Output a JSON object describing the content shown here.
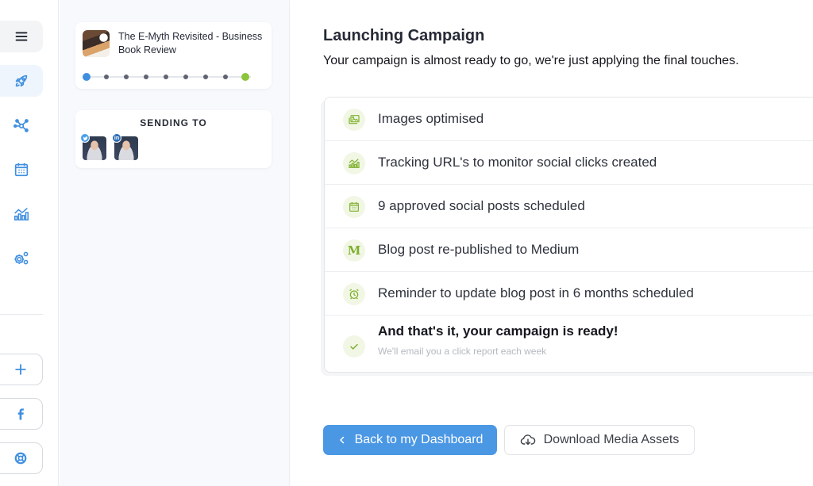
{
  "colors": {
    "accent_blue": "#4a97e4",
    "success_green": "#7fb02e",
    "success_bg": "#f1f7e4",
    "sidebar_icon": "#3f8fe0"
  },
  "sidebar": {
    "items": [
      {
        "name": "menu",
        "icon": "hamburger-icon"
      },
      {
        "name": "campaigns",
        "icon": "rocket-icon",
        "active": true
      },
      {
        "name": "network",
        "icon": "network-icon"
      },
      {
        "name": "calendar",
        "icon": "calendar-icon"
      },
      {
        "name": "analytics",
        "icon": "analytics-icon"
      },
      {
        "name": "settings",
        "icon": "gears-icon"
      }
    ],
    "bottom_items": [
      {
        "name": "add",
        "icon": "plus-icon"
      },
      {
        "name": "facebook",
        "icon": "facebook-icon"
      },
      {
        "name": "help",
        "icon": "lifebuoy-icon"
      }
    ]
  },
  "campaign_card": {
    "title": "The E-Myth Revisited - Business Book Review",
    "steps_total": 9,
    "steps_completed": 9
  },
  "sending_to": {
    "label": "SENDING TO",
    "accounts": [
      {
        "network": "twitter",
        "badge": "t"
      },
      {
        "network": "linkedin",
        "badge": "in"
      }
    ]
  },
  "main": {
    "title": "Launching Campaign",
    "subtitle": "Your campaign is almost ready to go, we're just applying the final touches.",
    "checklist": [
      {
        "icon": "images-icon",
        "text": "Images optimised"
      },
      {
        "icon": "tracking-chart-icon",
        "text": "Tracking URL's to monitor social clicks created"
      },
      {
        "icon": "calendar-icon",
        "text": "9 approved social posts scheduled"
      },
      {
        "icon": "medium-icon",
        "text": "Blog post re-published to Medium"
      },
      {
        "icon": "alarm-clock-icon",
        "text": "Reminder to update blog post in 6 months scheduled"
      }
    ],
    "final": {
      "title": "And that's it, your campaign is ready!",
      "subtitle": "We'll email you a click report each week"
    },
    "buttons": {
      "back": "Back to my Dashboard",
      "download": "Download Media Assets"
    }
  }
}
